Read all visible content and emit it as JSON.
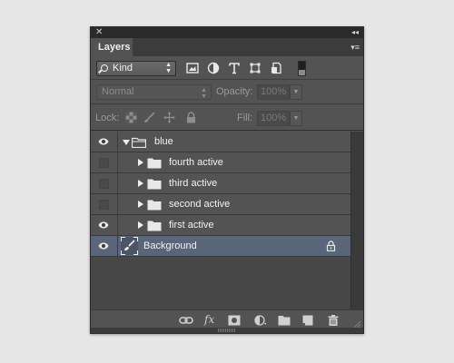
{
  "panel": {
    "close_glyph": "✕",
    "collapse_glyph": "◂◂",
    "tab_label": "Layers",
    "menu_glyph": "▾≡"
  },
  "filter": {
    "kind_label": "Kind",
    "icons": [
      "pixel-filter-icon",
      "adjustment-filter-icon",
      "type-filter-icon",
      "shape-filter-icon",
      "smart-object-filter-icon"
    ]
  },
  "blend": {
    "mode": "Normal",
    "opacity_label": "Opacity:",
    "opacity_value": "100%"
  },
  "lock": {
    "label": "Lock:",
    "icons": [
      "lock-transparent-pixels-icon",
      "lock-image-pixels-icon",
      "lock-position-icon",
      "lock-all-icon"
    ],
    "fill_label": "Fill:",
    "fill_value": "100%"
  },
  "layers": [
    {
      "name": "blue",
      "type": "group",
      "expanded": true,
      "visible": true,
      "indent": 0
    },
    {
      "name": "fourth active",
      "type": "group",
      "expanded": false,
      "visible": false,
      "indent": 1
    },
    {
      "name": "third active",
      "type": "group",
      "expanded": false,
      "visible": false,
      "indent": 1
    },
    {
      "name": "second active",
      "type": "group",
      "expanded": false,
      "visible": false,
      "indent": 1
    },
    {
      "name": "first active",
      "type": "group",
      "expanded": false,
      "visible": true,
      "indent": 1
    },
    {
      "name": "Background",
      "type": "background",
      "visible": true,
      "selected": true,
      "locked": true,
      "indent": 0
    }
  ],
  "footer": {
    "fx_label": "fx",
    "icons": [
      "link-layers-icon",
      "layer-style-icon",
      "layer-mask-icon",
      "adjustment-layer-icon",
      "new-group-icon",
      "new-layer-icon",
      "delete-layer-icon"
    ]
  },
  "colors": {
    "panel_bg": "#535353",
    "selected_row": "#596679",
    "text": "#f2f2f2"
  }
}
